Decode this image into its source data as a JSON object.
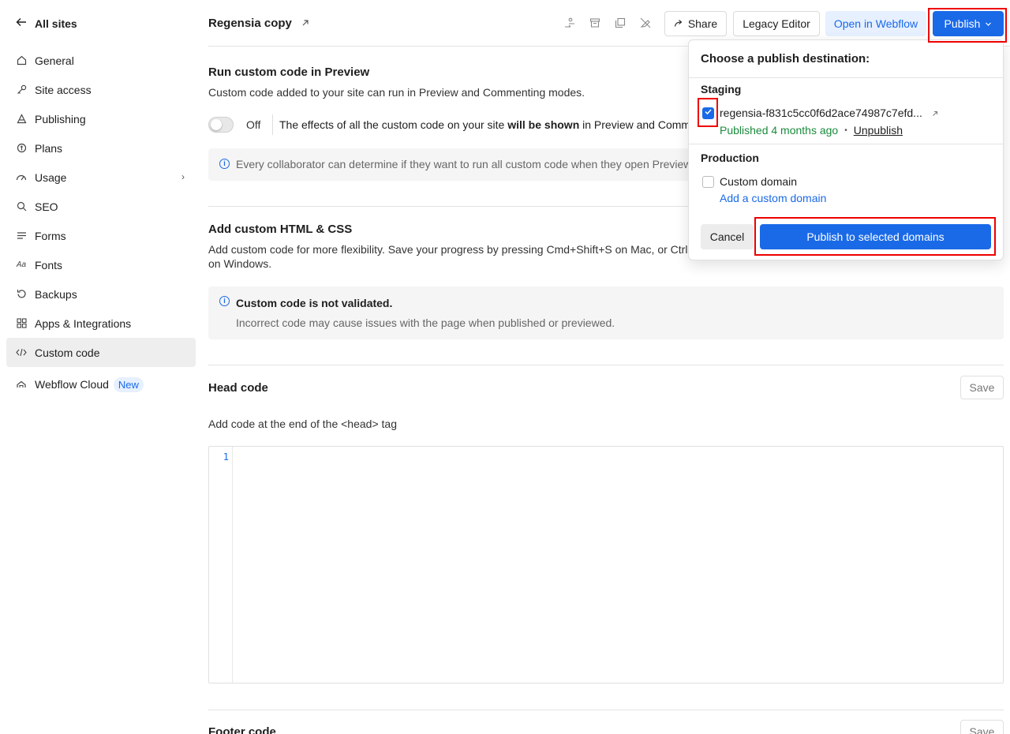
{
  "sidebar": {
    "back_label": "All sites",
    "items": [
      {
        "label": "General",
        "icon": "home-icon"
      },
      {
        "label": "Site access",
        "icon": "key-icon"
      },
      {
        "label": "Publishing",
        "icon": "publish-icon"
      },
      {
        "label": "Plans",
        "icon": "plans-icon"
      },
      {
        "label": "Usage",
        "icon": "gauge-icon"
      },
      {
        "label": "SEO",
        "icon": "search-icon"
      },
      {
        "label": "Forms",
        "icon": "forms-icon"
      },
      {
        "label": "Fonts",
        "icon": "fonts-icon"
      },
      {
        "label": "Backups",
        "icon": "history-icon"
      },
      {
        "label": "Apps & Integrations",
        "icon": "apps-icon"
      },
      {
        "label": "Custom code",
        "icon": "code-icon"
      },
      {
        "label": "Webflow Cloud",
        "icon": "cloud-icon",
        "badge": "New"
      }
    ],
    "active": "Custom code"
  },
  "header": {
    "site_title": "Regensia copy",
    "share_label": "Share",
    "legacy_label": "Legacy Editor",
    "open_label": "Open in Webflow",
    "publish_label": "Publish"
  },
  "main": {
    "run_title": "Run custom code in Preview",
    "run_desc": "Custom code added to your site can run in Preview and Commenting modes.",
    "toggle_label": "Off",
    "effects_pre": "The effects of all the custom code on your site ",
    "effects_bold": "will be shown",
    "effects_post": " in Preview and Comme",
    "collab_info": "Every collaborator can determine if they want to run all custom code when they open Preview",
    "add_title": "Add custom HTML & CSS",
    "add_desc_1": "Add custom code for more flexibility. Save your progress by pressing Cmd+Shift+S on Mac, or Ctrl+",
    "add_desc_2": "on Windows.",
    "warn_title": "Custom code is not validated.",
    "warn_desc": "Incorrect code may cause issues with the page when published or previewed.",
    "head_title": "Head code",
    "head_desc": "Add code at the end of the <head> tag",
    "save_label": "Save",
    "line_number": "1",
    "footer_title": "Footer code"
  },
  "popup": {
    "title": "Choose a publish destination:",
    "staging_label": "Staging",
    "staging_domain": "regensia-f831c5cc0f6d2ace74987c7efd...",
    "published_status": "Published 4 months ago",
    "unpublish_label": "Unpublish",
    "production_label": "Production",
    "custom_domain_label": "Custom domain",
    "add_domain_label": "Add a custom domain",
    "cancel_label": "Cancel",
    "publish_selected_label": "Publish to selected domains"
  },
  "colors": {
    "accent": "#1a6ae8",
    "highlight": "#e00000",
    "success": "#1a8a3c"
  }
}
